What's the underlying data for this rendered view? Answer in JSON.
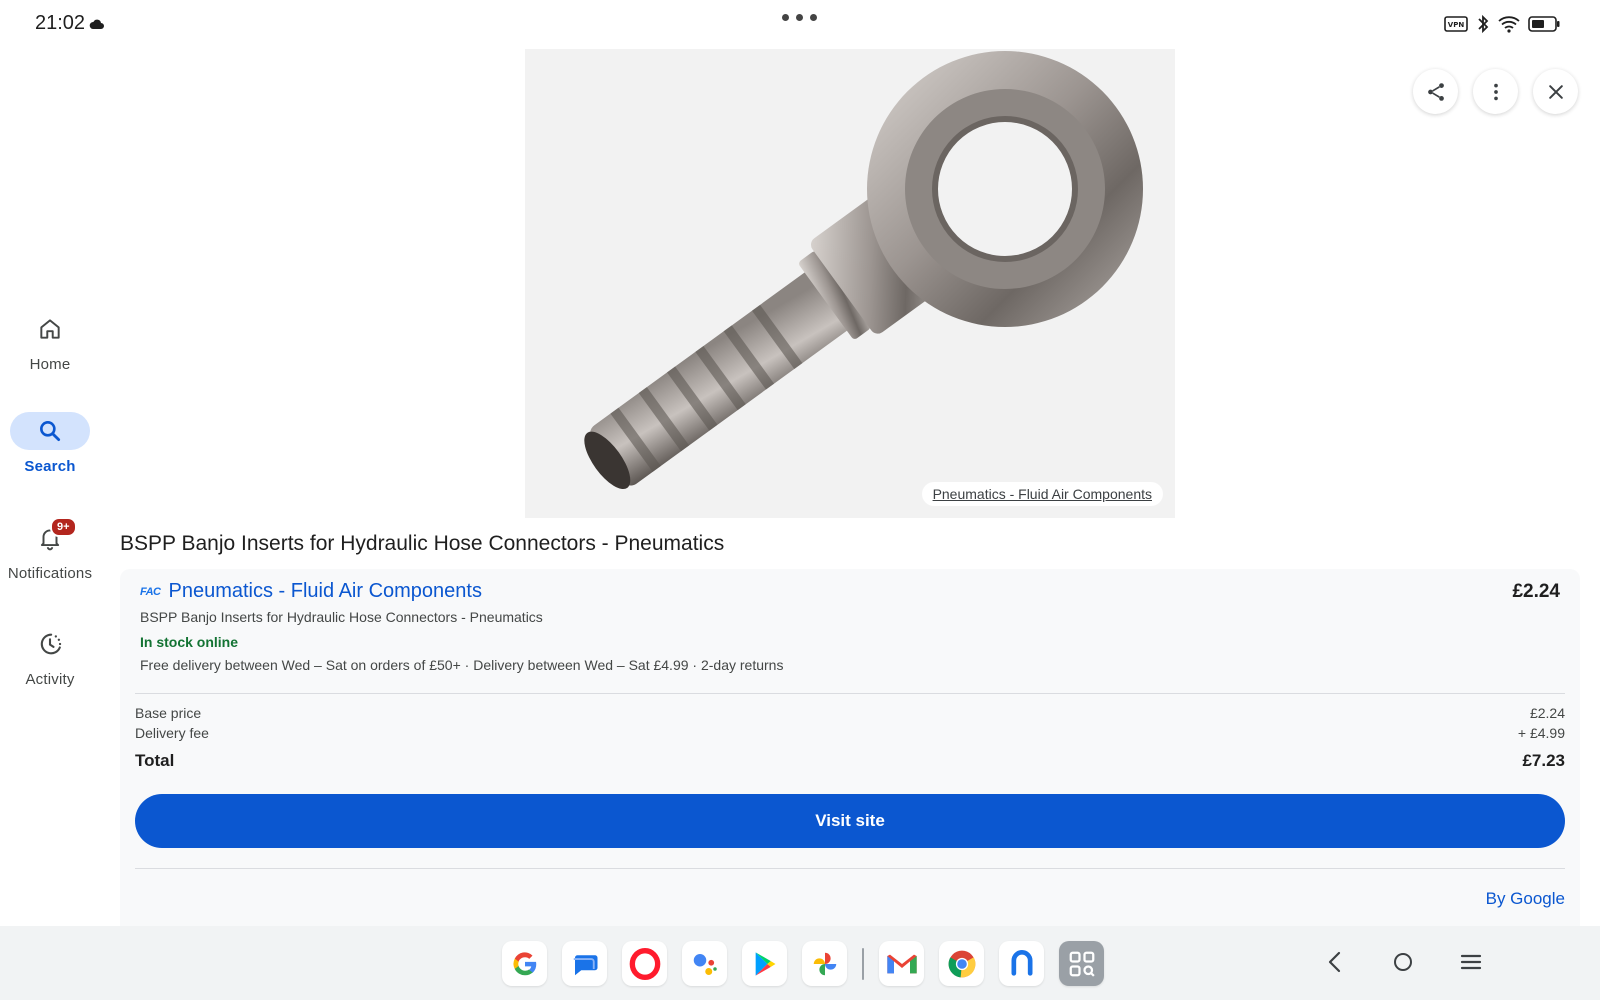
{
  "status_bar": {
    "time": "21:02",
    "vpn_label": "VPN"
  },
  "nav_rail": {
    "items": [
      {
        "label": "Home",
        "icon": "home-icon",
        "active": false
      },
      {
        "label": "Search",
        "icon": "search-icon",
        "active": true
      },
      {
        "label": "Notifications",
        "icon": "bell-icon",
        "active": false,
        "badge": "9+"
      },
      {
        "label": "Activity",
        "icon": "history-icon",
        "active": false
      }
    ]
  },
  "image": {
    "source_label": "Pneumatics - Fluid Air Components"
  },
  "actions": {
    "share": "share-icon",
    "more": "more-vert-icon",
    "close": "close-icon"
  },
  "product": {
    "title": "BSPP Banjo Inserts for Hydraulic Hose Connectors - Pneumatics"
  },
  "offer": {
    "merchant_logo": "FAC",
    "merchant_name": "Pneumatics - Fluid Air Components",
    "price": "£2.24",
    "description": "BSPP Banjo Inserts for Hydraulic Hose Connectors - Pneumatics",
    "stock": "In stock online",
    "delivery": "Free delivery between Wed – Sat on orders of £50+ · Delivery between Wed – Sat £4.99 · 2-day returns",
    "base_price_label": "Base price",
    "base_price_value": "£2.24",
    "delivery_fee_label": "Delivery fee",
    "delivery_fee_value": "+ £4.99",
    "total_label": "Total",
    "total_value": "£7.23",
    "visit_button": "Visit site",
    "by_google": "By Google"
  },
  "dock": {
    "apps": [
      "google-icon",
      "messages-icon",
      "opera-icon",
      "assistant-icon",
      "play-store-icon",
      "photos-icon",
      "gmail-icon",
      "chrome-icon",
      "nova-icon",
      "app-drawer-icon"
    ]
  },
  "colors": {
    "accent": "#0b57d0",
    "stock_green": "#137333",
    "badge_red": "#b3261e"
  }
}
